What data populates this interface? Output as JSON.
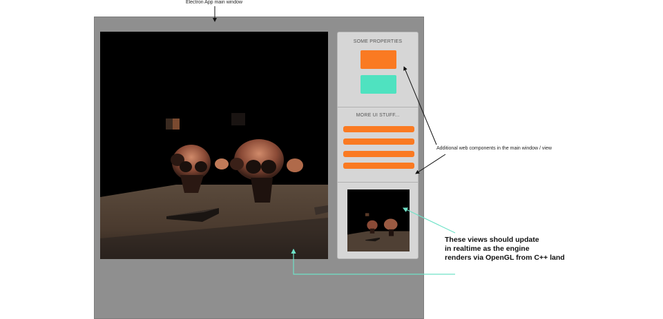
{
  "annotations": {
    "main_window": "Electron App main window",
    "web_components": "Additional web components in the main window / view",
    "realtime_lines": [
      "These views should update",
      "in realtime as the engine",
      "renders via OpenGL from C++ land"
    ]
  },
  "side_panel": {
    "section1_title": "SOME PROPERTIES",
    "section2_title": "MORE UI STUFF..."
  },
  "colors": {
    "orange": "#fa7a22",
    "teal": "#4fe2c0",
    "window_gray": "#8f8f8f",
    "panel_gray": "#d6d6d6"
  }
}
